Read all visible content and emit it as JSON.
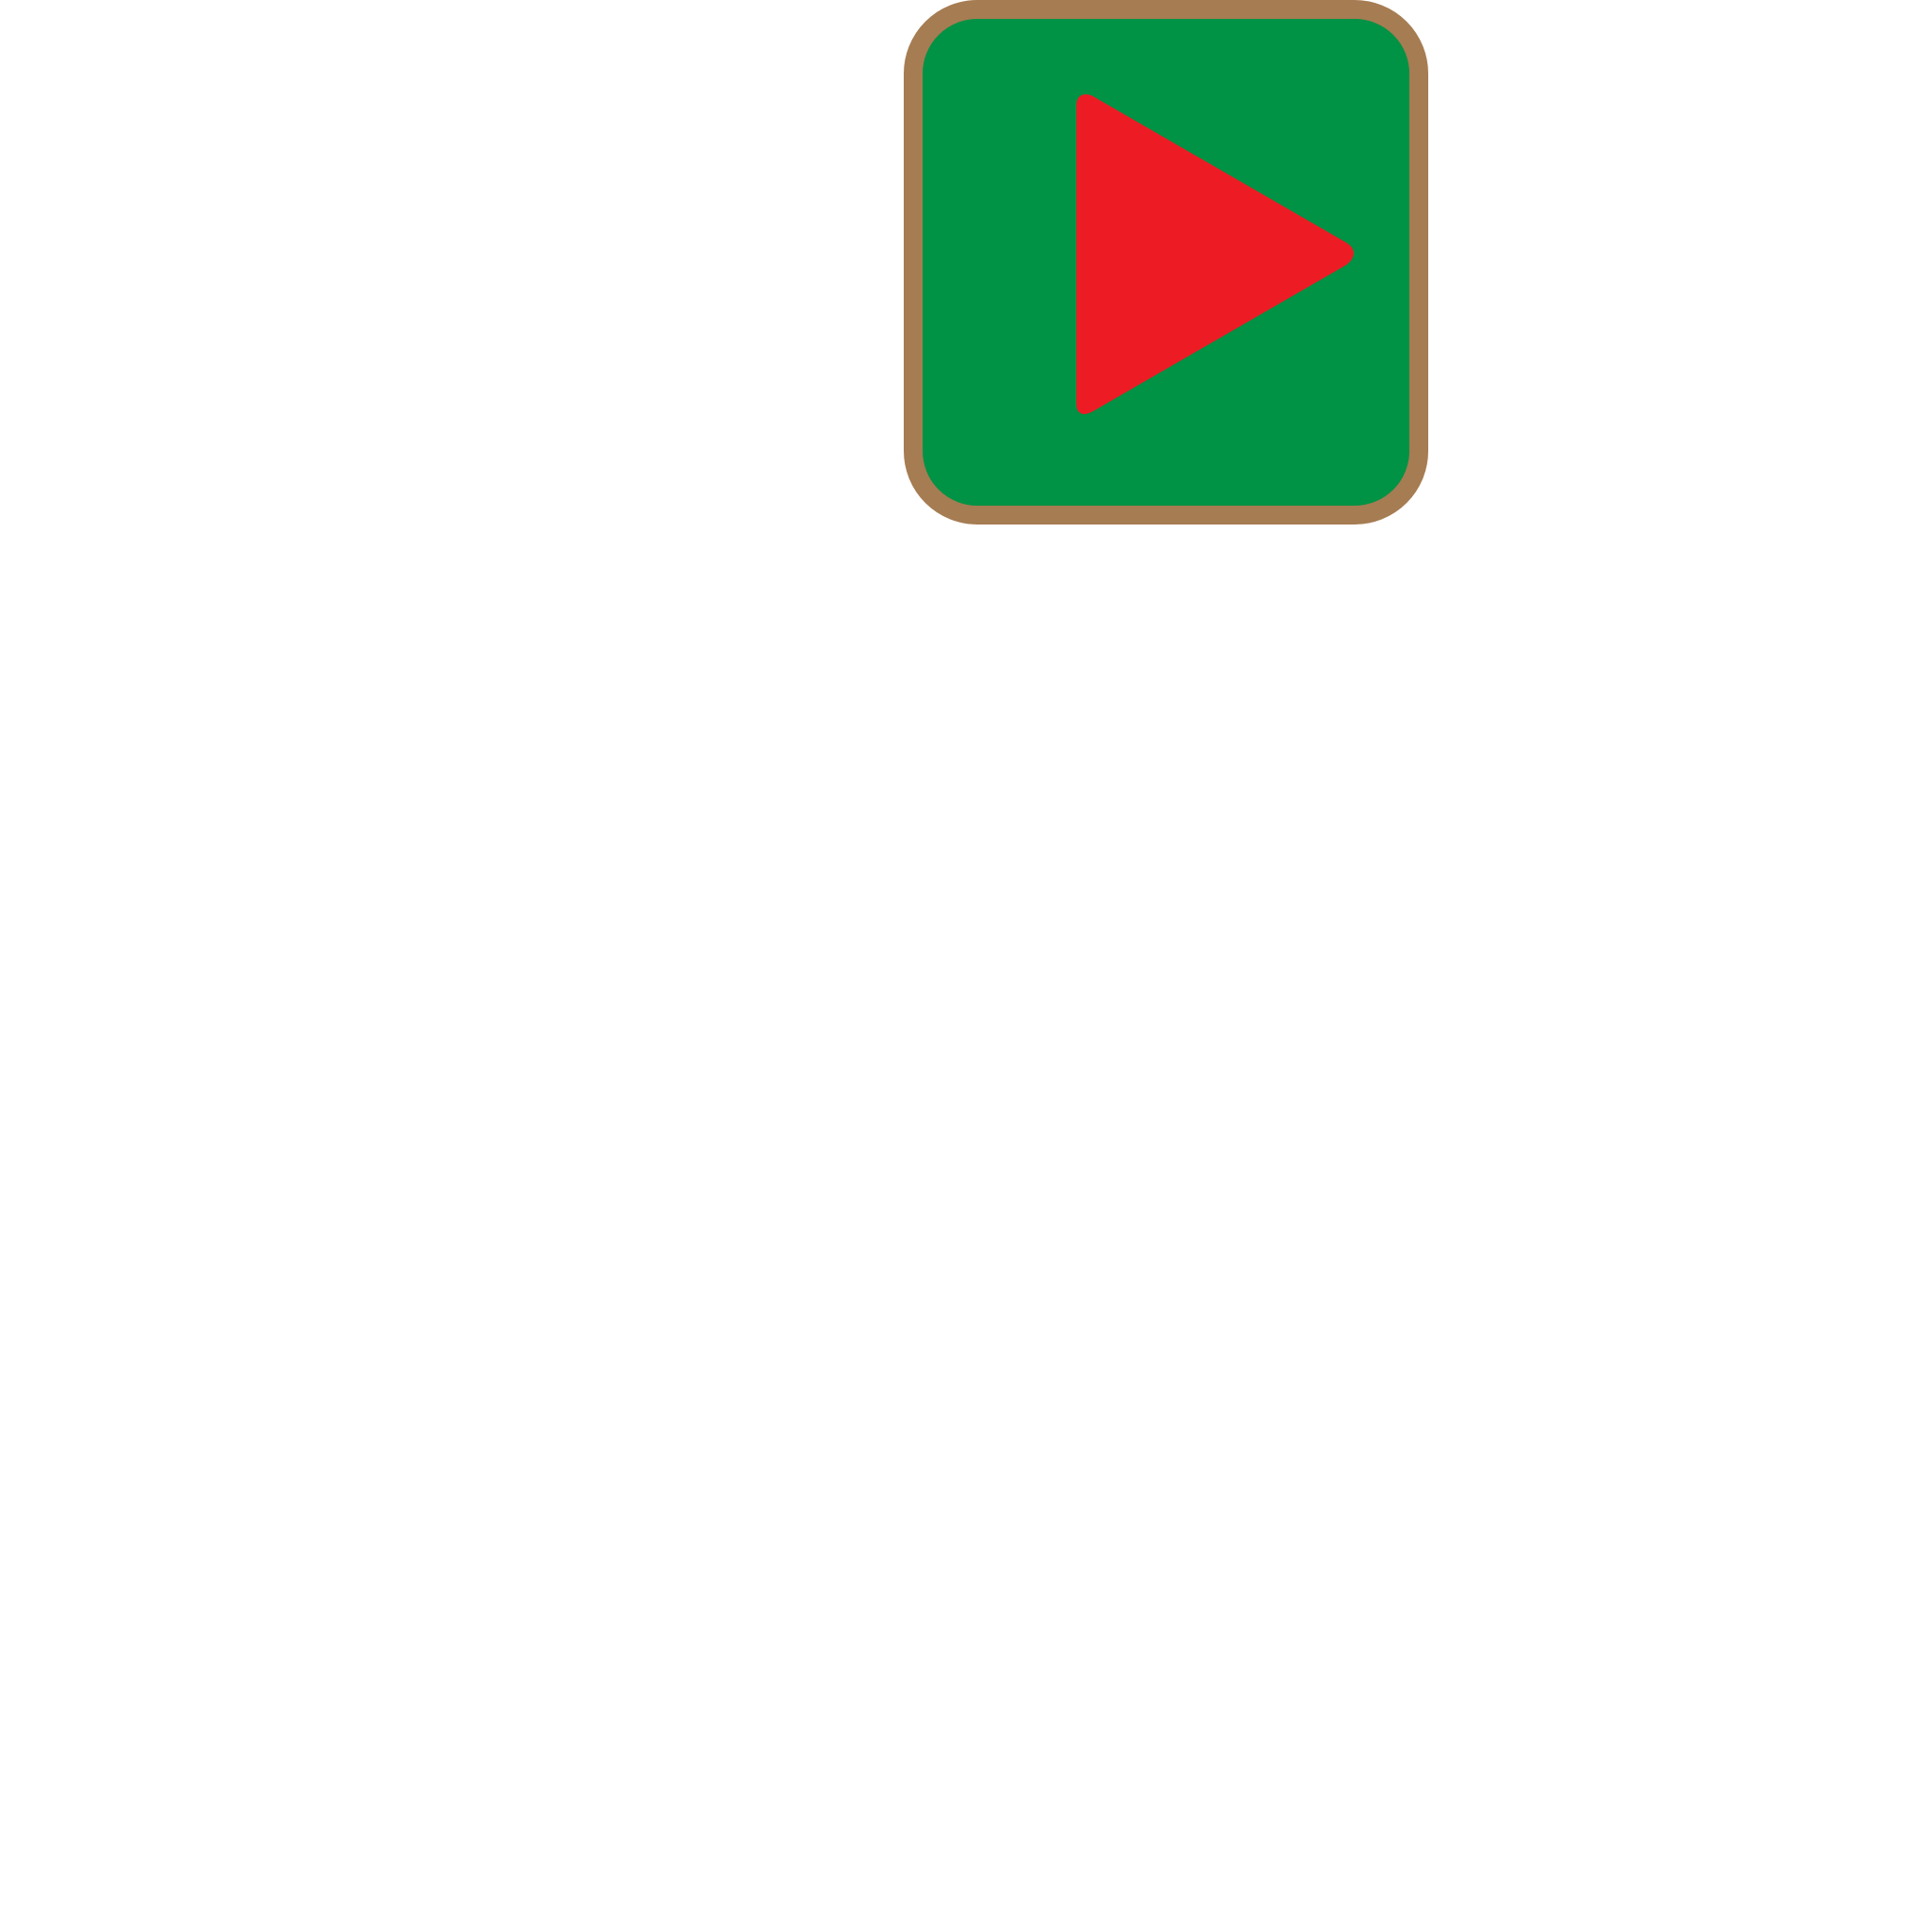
{
  "play_button": {
    "icon": "play-icon",
    "colors": {
      "background": "#009245",
      "border": "#a67c52",
      "icon": "#ed1c24"
    }
  },
  "page": {
    "background": "#ffffff"
  }
}
